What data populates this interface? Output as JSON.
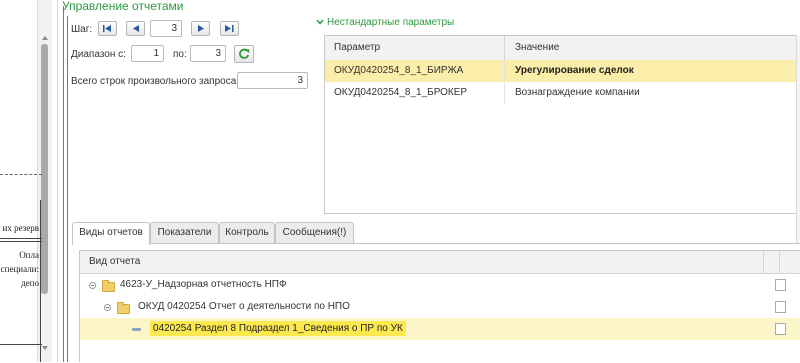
{
  "app": {
    "title": "Управление отчетами",
    "background_document": {
      "fragment1": "их резерв",
      "fragment2": "Опла",
      "fragment3": "специали:",
      "fragment4": "депо"
    }
  },
  "controls": {
    "step_label": "Шаг:",
    "step_value": "3",
    "range_from_label": "Диапазон с:",
    "range_from_value": "1",
    "range_to_label": "по:",
    "range_to_value": "3",
    "total_rows_label": "Всего строк произвольного запроса:",
    "total_rows_value": "3"
  },
  "nonstandard_params": {
    "title": "Нестандартные параметры",
    "columns": [
      "Параметр",
      "Значение"
    ],
    "rows": [
      {
        "param": "ОКУД0420254_8_1_БИРЖА",
        "value": "Урегулирование сделок",
        "selected": true
      },
      {
        "param": "ОКУД0420254_8_1_БРОКЕР",
        "value": "Вознаграждение компании",
        "selected": false
      }
    ]
  },
  "tabs": [
    {
      "label": "Виды отчетов",
      "active": true
    },
    {
      "label": "Показатели",
      "active": false
    },
    {
      "label": "Контроль",
      "active": false
    },
    {
      "label": "Сообщения(!)",
      "active": false
    }
  ],
  "report_tree": {
    "column": "Вид отчета",
    "rows": [
      {
        "label": "4623-У_Надзорная отчетность НПФ",
        "level": 0
      },
      {
        "label": "ОКУД 0420254 Отчет о деятельности по НПО",
        "level": 1
      },
      {
        "label": "0420254 Раздел 8 Подраздел 1_Сведения о ПР по УК",
        "level": 2,
        "selected": true
      }
    ]
  },
  "colors": {
    "accent_green": "#2c9a3d",
    "selection_yellow": "#fce94f",
    "row_highlight": "#fbeeaa"
  },
  "icons": {
    "first": "first-page-icon",
    "prev": "prev-page-icon",
    "next": "next-page-icon",
    "last": "last-page-icon",
    "refresh": "refresh-icon",
    "collapse": "collapse-chevron-icon",
    "folder": "folder-icon"
  }
}
